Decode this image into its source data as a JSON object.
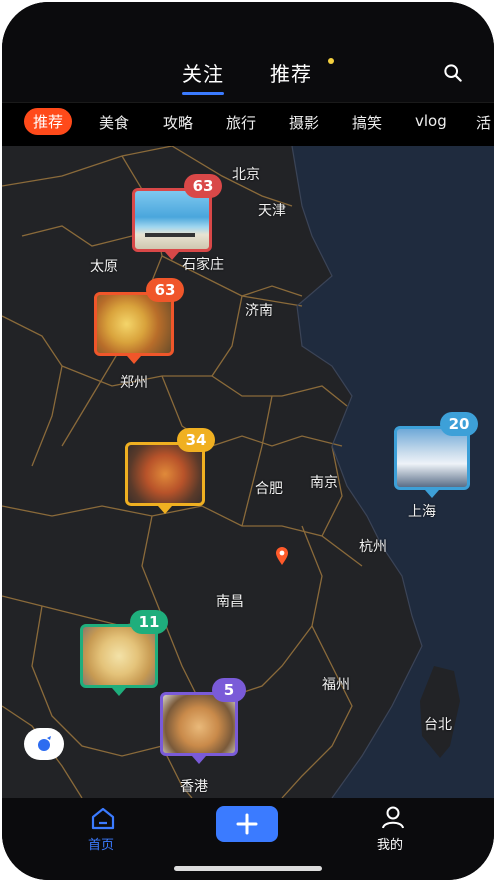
{
  "header": {
    "tabs": [
      {
        "label": "关注",
        "active": true
      },
      {
        "label": "推荐",
        "active": false,
        "has_dot": true
      }
    ]
  },
  "categories": [
    "推荐",
    "美食",
    "攻略",
    "旅行",
    "摄影",
    "搞笑",
    "vlog",
    "活"
  ],
  "map": {
    "cities": [
      "北京",
      "天津",
      "太原",
      "石家庄",
      "济南",
      "郑州",
      "合肥",
      "南京",
      "上海",
      "杭州",
      "南昌",
      "福州",
      "台北",
      "香港"
    ],
    "pins": [
      {
        "count": "63",
        "badge_color": "#d94848",
        "border_color": "#d94848",
        "photo": "beach"
      },
      {
        "count": "63",
        "badge_color": "#f0562a",
        "border_color": "#f0562a",
        "photo": "sandwich"
      },
      {
        "count": "34",
        "badge_color": "#f0b021",
        "border_color": "#f0b021",
        "photo": "roast-chicken"
      },
      {
        "count": "20",
        "badge_color": "#3da0d8",
        "border_color": "#3da0d8",
        "photo": "snowy-town"
      },
      {
        "count": "11",
        "badge_color": "#1fae7c",
        "border_color": "#1fae7c",
        "photo": "noodles"
      },
      {
        "count": "5",
        "badge_color": "#7a5bd8",
        "border_color": "#7a5bd8",
        "photo": "noodle-bowl"
      }
    ],
    "accent": "#3b7bff"
  },
  "bottom_nav": {
    "home_label": "首页",
    "mine_label": "我的"
  }
}
